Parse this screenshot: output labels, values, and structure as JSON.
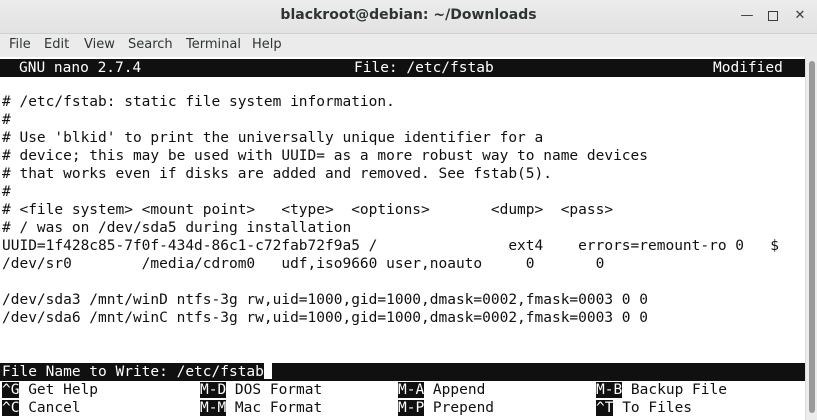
{
  "window": {
    "title": "blackroot@debian: ~/Downloads",
    "minimize_icon": "minimize-icon",
    "maximize_icon": "maximize-icon",
    "close_icon": "close-icon"
  },
  "menubar": {
    "items": [
      "File",
      "Edit",
      "View",
      "Search",
      "Terminal",
      "Help"
    ]
  },
  "nano": {
    "version": "GNU nano 2.7.4",
    "file": "File: /etc/fstab",
    "status": "Modified",
    "lines": [
      "# /etc/fstab: static file system information.",
      "#",
      "# Use 'blkid' to print the universally unique identifier for a",
      "# device; this may be used with UUID= as a more robust way to name devices",
      "# that works even if disks are added and removed. See fstab(5).",
      "#",
      "# <file system> <mount point>   <type>  <options>       <dump>  <pass>",
      "# / was on /dev/sda5 during installation",
      "UUID=1f428c85-7f0f-434d-86c1-c72fab72f9a5 /               ext4    errors=remount-ro 0   $",
      "/dev/sr0        /media/cdrom0   udf,iso9660 user,noauto     0       0",
      "",
      "/dev/sda3 /mnt/winD ntfs-3g rw,uid=1000,gid=1000,dmask=0002,fmask=0003 0 0",
      "/dev/sda6 /mnt/winC ntfs-3g rw,uid=1000,gid=1000,dmask=0002,fmask=0003 0 0"
    ],
    "prompt": "File Name to Write: /etc/fstab",
    "shortcuts": [
      {
        "key": "^G",
        "label": " Get Help"
      },
      {
        "key": "M-D",
        "label": " DOS Format"
      },
      {
        "key": "M-A",
        "label": " Append"
      },
      {
        "key": "M-B",
        "label": " Backup File"
      },
      {
        "key": "^C",
        "label": " Cancel"
      },
      {
        "key": "M-M",
        "label": " Mac Format"
      },
      {
        "key": "M-P",
        "label": " Prepend"
      },
      {
        "key": "^T",
        "label": " To Files"
      }
    ]
  },
  "colors": {
    "terminal_bg": "#ffffff",
    "terminal_fg": "#101010",
    "inverse_bg": "#101010",
    "inverse_fg": "#ffffff"
  }
}
